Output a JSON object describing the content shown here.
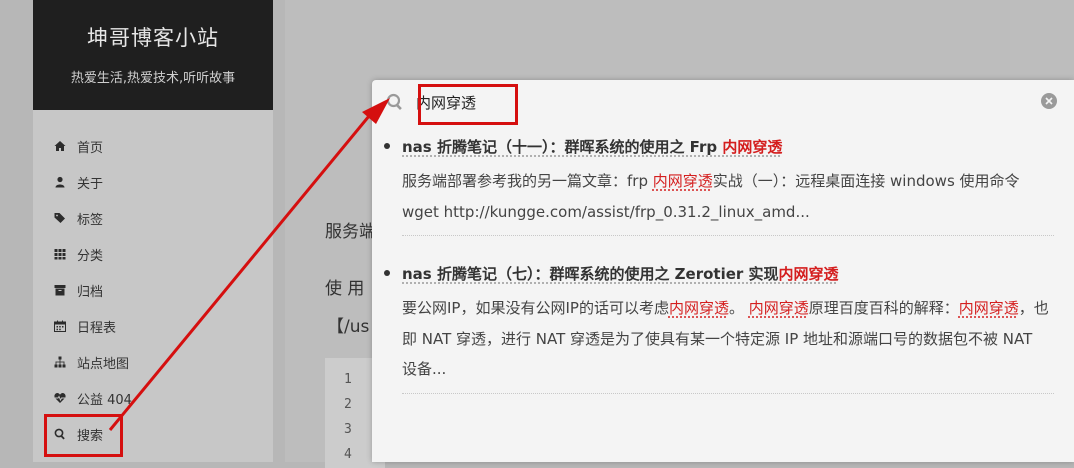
{
  "site": {
    "title": "坤哥博客小站",
    "subtitle": "热爱生活,热爱技术,听听故事"
  },
  "menu": {
    "items": [
      {
        "label": "首页",
        "icon": "home-icon"
      },
      {
        "label": "关于",
        "icon": "user-icon"
      },
      {
        "label": "标签",
        "icon": "tags-icon"
      },
      {
        "label": "分类",
        "icon": "grid-icon"
      },
      {
        "label": "归档",
        "icon": "archive-icon"
      },
      {
        "label": "日程表",
        "icon": "calendar-icon"
      },
      {
        "label": "站点地图",
        "icon": "sitemap-icon"
      },
      {
        "label": "公益 404",
        "icon": "heartbeat-icon"
      },
      {
        "label": "搜索",
        "icon": "search-icon"
      }
    ]
  },
  "background_content": {
    "line1": "服务端",
    "line2": "使 用",
    "line3": "【/us",
    "code_lines": [
      "1",
      "2",
      "3",
      "4"
    ]
  },
  "search": {
    "query": "内网穿透",
    "results": [
      {
        "title_prefix": "nas 折腾笔记（十一）：群晖系统的使用之 Frp ",
        "title_highlight": "内网穿透",
        "body_part1": "服务端部署参考我的另一篇文章：frp ",
        "body_hl1": "内网穿透",
        "body_part2": "实战（一）：远程桌面连接 windows 使用命令 wget http://kungge.com/assist/frp_0.31.2_linux_amd..."
      },
      {
        "title_prefix": "nas 折腾笔记（七）：群晖系统的使用之 Zerotier 实现",
        "title_highlight": "内网穿透",
        "body_part1": "要公网IP，如果没有公网IP的话可以考虑",
        "body_hl1": "内网穿透",
        "body_part2": "。 ",
        "body_hl2": "内网穿透",
        "body_part3": "原理百度百科的解释：",
        "body_hl3": "内网穿透",
        "body_part4": "，也即 NAT 穿透，进行 NAT 穿透是为了使具有某一个特定源 IP 地址和源端口号的数据包不被 NAT 设备..."
      }
    ]
  },
  "colors": {
    "highlight": "#d41e1e",
    "annotation": "#d50f0f"
  }
}
